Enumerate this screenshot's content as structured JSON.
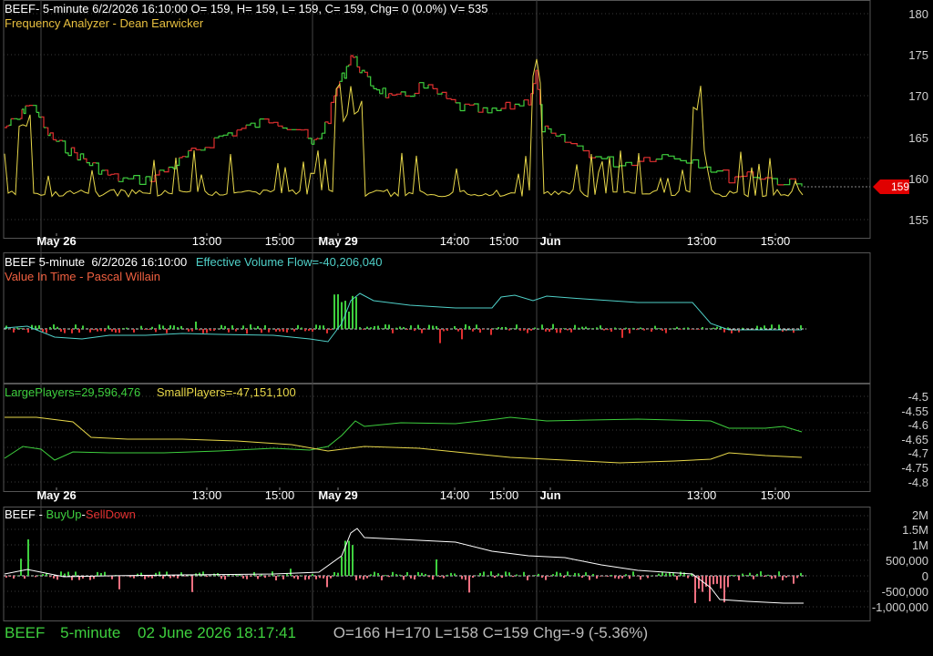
{
  "colors": {
    "background": "#000000",
    "grid": "#3a3a3a",
    "up": "#3ecf3e",
    "down": "#e03030",
    "price_line": "#e8d84a",
    "flow_line": "#4fd0c8",
    "white": "#ffffff",
    "label": "#d0d0d0"
  },
  "panel1": {
    "header": "BEEF- 5-minute 6/2/2026 16:10:00 O= 159, H= 159, L= 159, C= 159, Chg= 0 (0.0%) V= 535",
    "indicator": "Frequency Analyzer - Dean Earwicker",
    "y_ticks": [
      "180",
      "175",
      "170",
      "165",
      "160",
      "155"
    ],
    "last_price": "159"
  },
  "time_axis": {
    "labels": [
      "May 26",
      "13:00",
      "15:00",
      "May 29",
      "14:00",
      "15:00",
      "Jun",
      "13:00",
      "15:00"
    ]
  },
  "panel2": {
    "header_left": "BEEF 5-minute  6/2/2026 16:10:00",
    "header_right": "Effective Volume Flow=-40,206,040",
    "indicator": "Value In Time - Pascal Willain"
  },
  "panel3": {
    "large": "LargePlayers=29,596,476",
    "small": "SmallPlayers=-47,151,100",
    "y_ticks": [
      "-4.5",
      "-4.55",
      "-4.6",
      "-4.65",
      "-4.7",
      "-4.75",
      "-4.8"
    ]
  },
  "panel4": {
    "prefix": "BEEF - ",
    "buy": "BuyUp",
    "dash": "-",
    "sell": "SellDown",
    "y_ticks": [
      "2M",
      "1.5M",
      "1M",
      "500,000",
      "0",
      "-500,000",
      "-1,000,000"
    ]
  },
  "status": {
    "symbol": "BEEF",
    "interval": "5-minute",
    "datetime": "02 June 2026 18:17:41",
    "ohlc": "O=166  H=170  L=158  C=159  Chg=-9 (-5.36%)"
  }
}
